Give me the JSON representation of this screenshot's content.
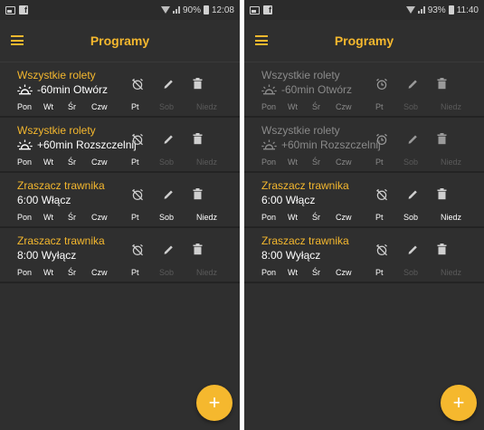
{
  "colors": {
    "accent": "#f5b82e",
    "background": "#2f2f2f",
    "inactive_text": "#8a8a8a",
    "disabled_day": "#5a5a5a"
  },
  "screens": [
    {
      "status": {
        "battery": "90%",
        "time": "12:08"
      },
      "title": "Programy",
      "programs": [
        {
          "name": "Wszystkie rolety",
          "active": true,
          "icon": "sunrise-icon",
          "action": "-60min  Otwórz",
          "alarm_enabled": false,
          "days": [
            {
              "label": "Pon",
              "on": true
            },
            {
              "label": "Wt",
              "on": true
            },
            {
              "label": "Śr",
              "on": true
            },
            {
              "label": "Czw",
              "on": true
            },
            {
              "label": "Pt",
              "on": true
            },
            {
              "label": "Sob",
              "on": false
            },
            {
              "label": "Niedz",
              "on": false
            }
          ]
        },
        {
          "name": "Wszystkie rolety",
          "active": true,
          "icon": "sunset-icon",
          "action": "+60min  Rozszczelnij",
          "alarm_enabled": false,
          "days": [
            {
              "label": "Pon",
              "on": true
            },
            {
              "label": "Wt",
              "on": true
            },
            {
              "label": "Śr",
              "on": true
            },
            {
              "label": "Czw",
              "on": true
            },
            {
              "label": "Pt",
              "on": true
            },
            {
              "label": "Sob",
              "on": false
            },
            {
              "label": "Niedz",
              "on": false
            }
          ]
        },
        {
          "name": "Zraszacz trawnika",
          "active": true,
          "icon": "",
          "action": "6:00  Włącz",
          "alarm_enabled": false,
          "days": [
            {
              "label": "Pon",
              "on": true
            },
            {
              "label": "Wt",
              "on": true
            },
            {
              "label": "Śr",
              "on": true
            },
            {
              "label": "Czw",
              "on": true
            },
            {
              "label": "Pt",
              "on": true
            },
            {
              "label": "Sob",
              "on": true
            },
            {
              "label": "Niedz",
              "on": true
            }
          ]
        },
        {
          "name": "Zraszacz trawnika",
          "active": true,
          "icon": "",
          "action": "8:00  Wyłącz",
          "alarm_enabled": false,
          "days": [
            {
              "label": "Pon",
              "on": true
            },
            {
              "label": "Wt",
              "on": true
            },
            {
              "label": "Śr",
              "on": true
            },
            {
              "label": "Czw",
              "on": true
            },
            {
              "label": "Pt",
              "on": true
            },
            {
              "label": "Sob",
              "on": false
            },
            {
              "label": "Niedz",
              "on": false
            }
          ]
        }
      ],
      "fab": "+"
    },
    {
      "status": {
        "battery": "93%",
        "time": "11:40"
      },
      "title": "Programy",
      "programs": [
        {
          "name": "Wszystkie rolety",
          "active": false,
          "icon": "sunrise-icon",
          "action": "-60min  Otwórz",
          "alarm_enabled": true,
          "days": [
            {
              "label": "Pon",
              "on": true
            },
            {
              "label": "Wt",
              "on": true
            },
            {
              "label": "Śr",
              "on": true
            },
            {
              "label": "Czw",
              "on": true
            },
            {
              "label": "Pt",
              "on": true
            },
            {
              "label": "Sob",
              "on": false
            },
            {
              "label": "Niedz",
              "on": false
            }
          ]
        },
        {
          "name": "Wszystkie rolety",
          "active": false,
          "icon": "sunset-icon",
          "action": "+60min  Rozszczelnij",
          "alarm_enabled": true,
          "days": [
            {
              "label": "Pon",
              "on": true
            },
            {
              "label": "Wt",
              "on": true
            },
            {
              "label": "Śr",
              "on": true
            },
            {
              "label": "Czw",
              "on": true
            },
            {
              "label": "Pt",
              "on": true
            },
            {
              "label": "Sob",
              "on": false
            },
            {
              "label": "Niedz",
              "on": false
            }
          ]
        },
        {
          "name": "Zraszacz trawnika",
          "active": true,
          "icon": "",
          "action": "6:00  Włącz",
          "alarm_enabled": false,
          "days": [
            {
              "label": "Pon",
              "on": true
            },
            {
              "label": "Wt",
              "on": true
            },
            {
              "label": "Śr",
              "on": true
            },
            {
              "label": "Czw",
              "on": true
            },
            {
              "label": "Pt",
              "on": true
            },
            {
              "label": "Sob",
              "on": true
            },
            {
              "label": "Niedz",
              "on": true
            }
          ]
        },
        {
          "name": "Zraszacz trawnika",
          "active": true,
          "icon": "",
          "action": "8:00  Wyłącz",
          "alarm_enabled": false,
          "days": [
            {
              "label": "Pon",
              "on": true
            },
            {
              "label": "Wt",
              "on": true
            },
            {
              "label": "Śr",
              "on": true
            },
            {
              "label": "Czw",
              "on": true
            },
            {
              "label": "Pt",
              "on": true
            },
            {
              "label": "Sob",
              "on": false
            },
            {
              "label": "Niedz",
              "on": false
            }
          ]
        }
      ],
      "fab": "+"
    }
  ]
}
